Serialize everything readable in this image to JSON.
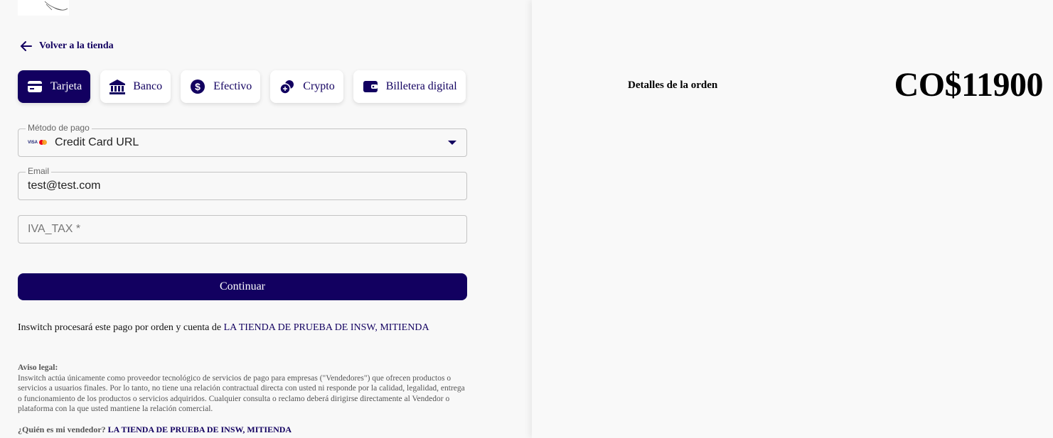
{
  "nav": {
    "back_label": "Volver a la tienda"
  },
  "payment_tabs": [
    {
      "label": "Tarjeta",
      "icon": "credit-card-icon",
      "active": true
    },
    {
      "label": "Banco",
      "icon": "bank-icon",
      "active": false
    },
    {
      "label": "Efectivo",
      "icon": "dollar-icon",
      "active": false
    },
    {
      "label": "Crypto",
      "icon": "crypto-icon",
      "active": false
    },
    {
      "label": "Billetera digital",
      "icon": "wallet-icon",
      "active": false
    }
  ],
  "form": {
    "payment_method": {
      "label": "Método de pago",
      "value": "Credit Card URL",
      "brand_text": "VISA"
    },
    "email": {
      "label": "Email",
      "value": "test@test.com"
    },
    "iva_tax": {
      "placeholder": "IVA_TAX *"
    },
    "continue_label": "Continuar"
  },
  "processing": {
    "text": "Inswitch procesará este pago por orden y cuenta de ",
    "merchant": "LA TIENDA DE PRUEBA DE INSW, MITIENDA"
  },
  "legal": {
    "title": "Aviso legal:",
    "body": "Inswitch actúa únicamente como proveedor tecnológico de servicios de pago para empresas (\"Vendedores\") que ofrecen productos o servicios a usuarios finales. Por lo tanto, no tiene una relación contractual directa con usted ni responde por la calidad, legalidad, entrega o funcionamiento de los productos o servicios adquiridos. Cualquier consulta o reclamo deberá dirigirse directamente al Vendedor o plataforma con la que usted mantiene la relación comercial.",
    "who_label": "¿Quién es mi vendedor?",
    "who_value": "LA TIENDA DE PRUEBA DE INSW, MITIENDA"
  },
  "order": {
    "title": "Detalles de la orden",
    "amount": "CO$11900"
  },
  "colors": {
    "brand": "#120060",
    "mastercard_red": "#eb001b",
    "mastercard_yellow": "#f79e1b"
  }
}
